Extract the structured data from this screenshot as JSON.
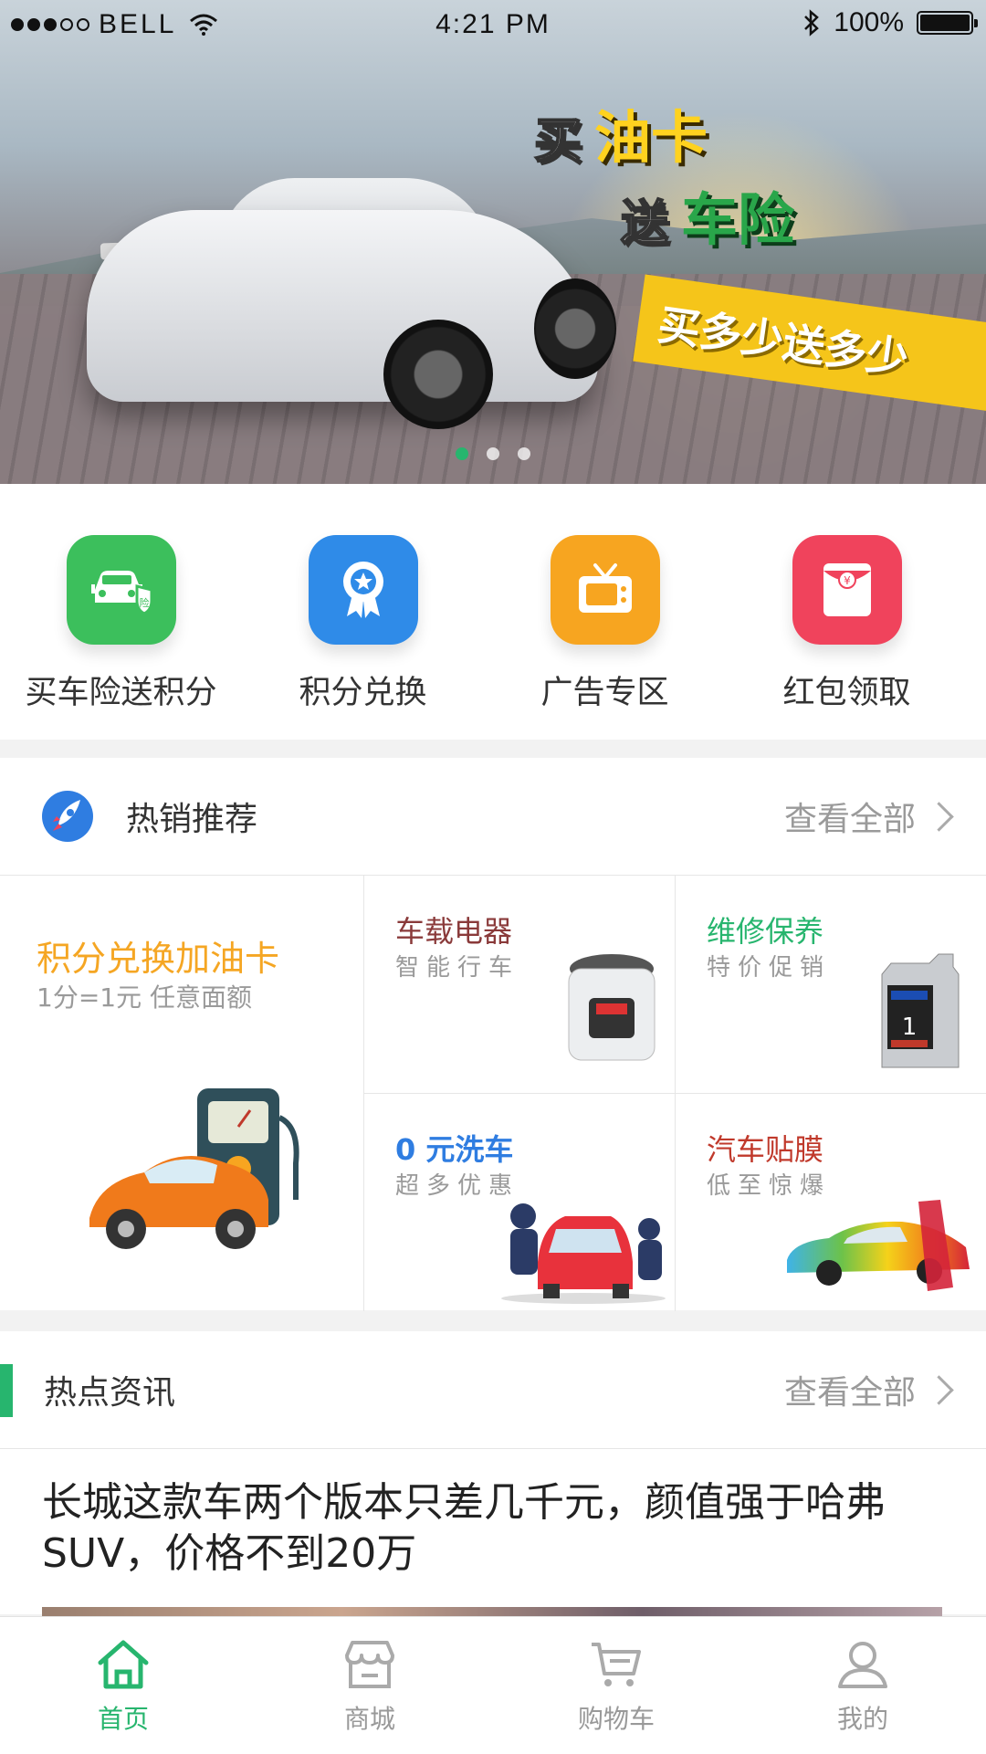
{
  "status_bar": {
    "carrier": "BELL",
    "time": "4:21 PM",
    "battery": "100%"
  },
  "banner": {
    "line1_a": "买",
    "line1_b": "油卡",
    "line2_a": "送",
    "line2_b": "车险",
    "ribbon": "买多少送多少",
    "dots": 3,
    "active_dot": 0
  },
  "quick_menu": [
    {
      "label": "买车险送积分",
      "icon": "car-insurance-icon",
      "color": "#3cbf5c"
    },
    {
      "label": "积分兑换",
      "icon": "medal-icon",
      "color": "#2f8be8"
    },
    {
      "label": "广告专区",
      "icon": "tv-icon",
      "color": "#f7a520"
    },
    {
      "label": "红包领取",
      "icon": "red-envelope-icon",
      "color": "#f0435c"
    }
  ],
  "hot": {
    "title": "热销推荐",
    "more": "查看全部",
    "featured": {
      "title": "积分兑换加油卡",
      "subtitle": "1分=1元 任意面额"
    },
    "cells": [
      {
        "title": "车载电器",
        "subtitle": "智能行车",
        "color": "#8a3a3a"
      },
      {
        "title": "维修保养",
        "subtitle": "特价促销",
        "color": "#27b56e"
      },
      {
        "title": "0 元洗车",
        "subtitle": "超多优惠",
        "color": "#2f7de1"
      },
      {
        "title": "汽车贴膜",
        "subtitle": "低至惊爆",
        "color": "#c0392b"
      }
    ]
  },
  "news": {
    "title": "热点资讯",
    "more": "查看全部",
    "headline": "长城这款车两个版本只差几千元，颜值强于哈弗SUV，价格不到20万"
  },
  "tabbar": [
    {
      "label": "首页",
      "icon": "home-icon",
      "active": true
    },
    {
      "label": "商城",
      "icon": "store-icon",
      "active": false
    },
    {
      "label": "购物车",
      "icon": "cart-icon",
      "active": false
    },
    {
      "label": "我的",
      "icon": "profile-icon",
      "active": false
    }
  ],
  "colors": {
    "accent": "#27b56e",
    "orange": "#f5a623"
  }
}
